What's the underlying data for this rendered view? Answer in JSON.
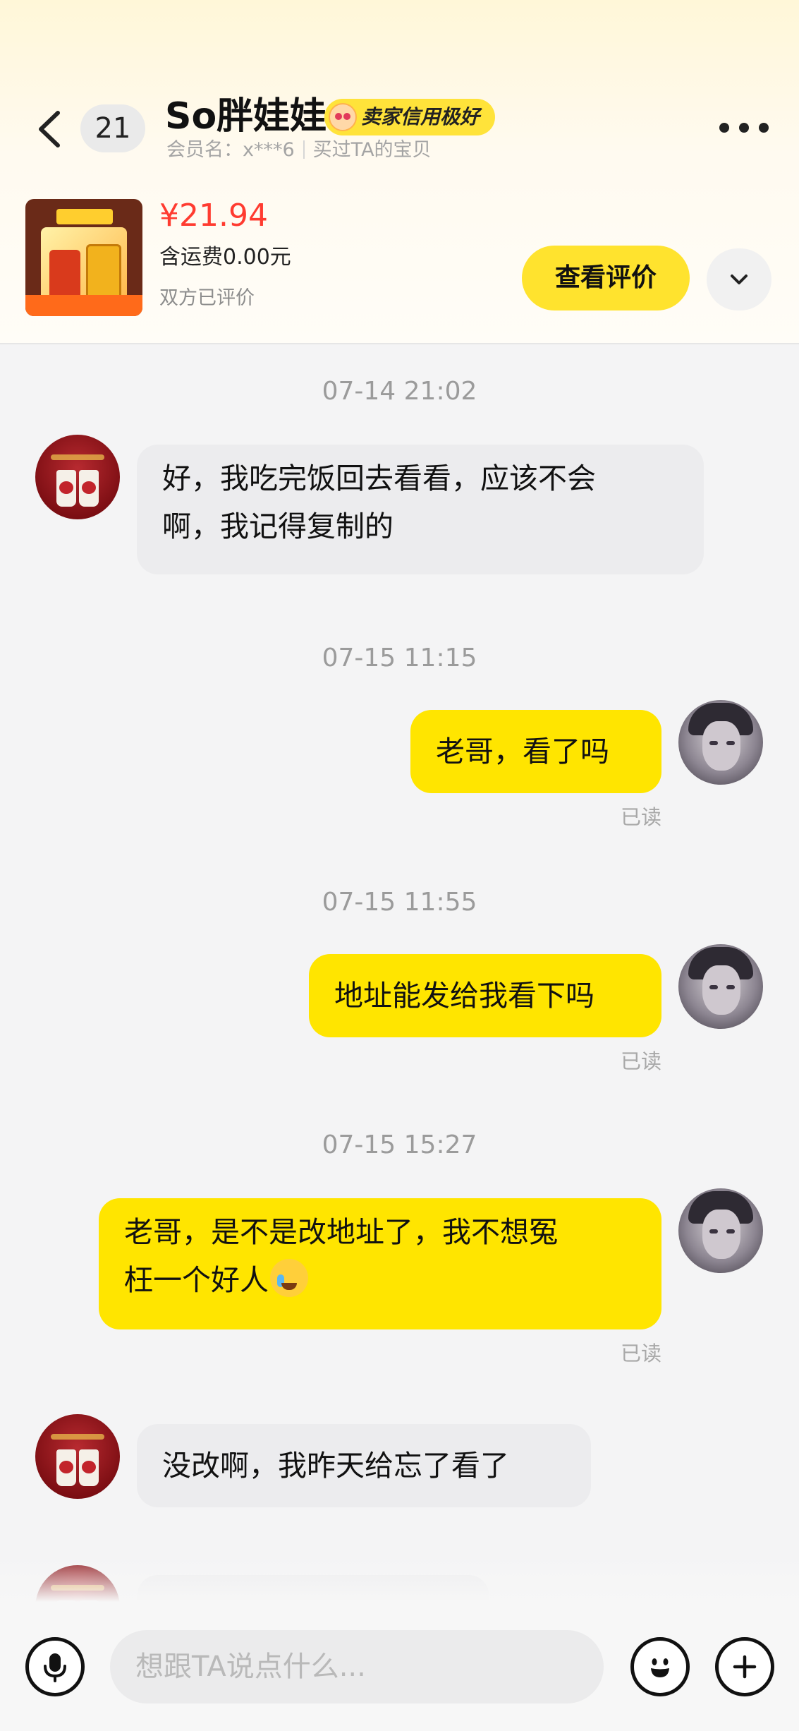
{
  "header": {
    "back_icon": "chevron-left-icon",
    "unread_count": "21",
    "title": "So胖娃娃",
    "credit_badge": "卖家信用极好",
    "member_label": "会员名：x***6",
    "bought_label": "买过TA的宝贝",
    "more_icon": "more-horizontal-icon"
  },
  "product": {
    "price": "¥21.94",
    "shipping": "含运费0.00元",
    "review_status": "双方已评价",
    "view_review_button": "查看评价",
    "collapse_icon": "chevron-down-icon"
  },
  "messages": [
    {
      "time": "07-14 21:02",
      "from": "seller",
      "lines": [
        "好，我吃完饭回去看看，应该不会",
        "啊，我记得复制的"
      ]
    },
    {
      "time": "07-15 11:15",
      "from": "me",
      "text": "老哥，看了吗",
      "status": "已读"
    },
    {
      "time": "07-15 11:55",
      "from": "me",
      "text": "地址能发给我看下吗",
      "status": "已读"
    },
    {
      "time": "07-15 15:27",
      "from": "me",
      "lines": [
        "老哥，是不是改地址了，我不想冤",
        "枉一个好人"
      ],
      "status": "已读",
      "emoji": "crying-laughing-emoji"
    },
    {
      "from": "seller",
      "text": "没改啊，我昨天给忘了看了"
    }
  ],
  "input": {
    "placeholder": "想跟TA说点什么...",
    "mic_icon": "microphone-icon",
    "emoji_icon": "smiley-icon",
    "plus_icon": "plus-icon"
  },
  "colors": {
    "accent_yellow": "#ffe500",
    "price_red": "#ff3b30",
    "incoming_bubble": "#ececee"
  }
}
